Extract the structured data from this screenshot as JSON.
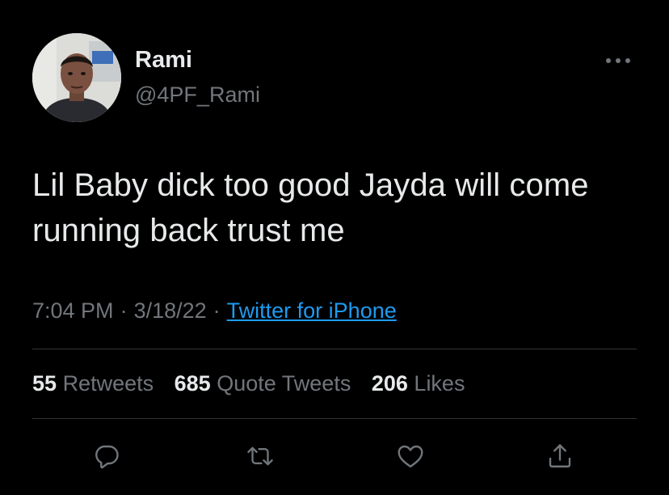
{
  "author": {
    "display_name": "Rami",
    "handle": "@4PF_Rami"
  },
  "tweet": {
    "text": "Lil Baby dick too good Jayda will come running back trust me",
    "time": "7:04 PM",
    "date": "3/18/22",
    "separator": "·",
    "source": "Twitter for iPhone"
  },
  "stats": {
    "retweets_count": "55",
    "retweets_label": "Retweets",
    "quotes_count": "685",
    "quotes_label": "Quote Tweets",
    "likes_count": "206",
    "likes_label": "Likes"
  },
  "icons": {
    "more": "more-horizontal-icon",
    "reply": "reply-icon",
    "retweet": "retweet-icon",
    "like": "heart-icon",
    "share": "share-icon"
  },
  "colors": {
    "background": "#000000",
    "text_primary": "#e7e9ea",
    "text_secondary": "#71767b",
    "link": "#1d9bf0",
    "divider": "#2f3336"
  }
}
